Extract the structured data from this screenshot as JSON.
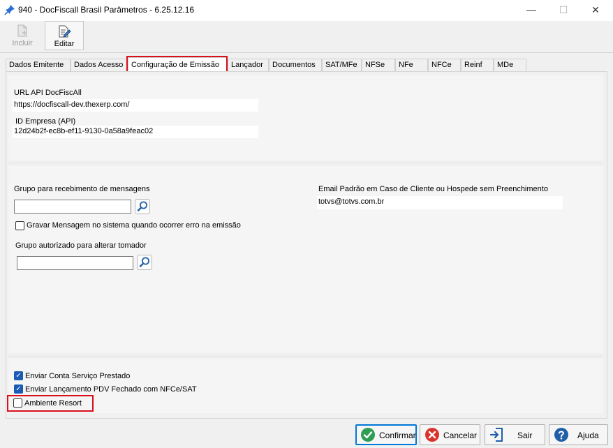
{
  "window": {
    "title": "940 - DocFiscall Brasil Parâmetros - 6.25.12.16",
    "controls": {
      "minimize": "—",
      "maximize": "☐",
      "close": "✕"
    }
  },
  "toolbar": {
    "incluir": "Incluir",
    "editar": "Editar"
  },
  "tabs": [
    "Dados Emitente",
    "Dados Acesso",
    "Configuração de Emissão",
    "Lançador",
    "Documentos",
    "SAT/MFe",
    "NFSe",
    "NFe",
    "NFCe",
    "Reinf",
    "MDe"
  ],
  "api": {
    "url_label": "URL API DocFiscAll",
    "url_value": "https://docfiscall-dev.thexerp.com/",
    "id_label": "ID Empresa (API)",
    "id_value": "12d24b2f-ec8b-ef11-9130-0a58a9feac02"
  },
  "messages": {
    "group_label": "Grupo para recebimento de mensagens",
    "group_value": "",
    "gravar_label": "Gravar Mensagem no sistema quando ocorrer erro na emissão",
    "gravar_checked": false,
    "tomador_label": "Grupo autorizado para alterar tomador",
    "tomador_value": "",
    "email_label": "Email Padrão em Caso de Cliente ou Hospede sem Preenchimento",
    "email_value": "totvs@totvs.com.br"
  },
  "options": {
    "enviar_conta": {
      "label": "Enviar Conta Serviço Prestado",
      "checked": true
    },
    "enviar_pdv": {
      "label": "Enviar Lançamento PDV Fechado com NFCe/SAT",
      "checked": true
    },
    "ambiente_resort": {
      "label": "Ambiente Resort",
      "checked": false
    }
  },
  "buttons": {
    "confirmar": "Confirmar",
    "cancelar": "Cancelar",
    "sair": "Sair",
    "ajuda": "Ajuda"
  },
  "colors": {
    "highlight": "#d7101b",
    "accent": "#1c5bb5",
    "confirm_green": "#2e9e55",
    "cancel_red": "#d9342b",
    "help_blue": "#1f5fa8"
  }
}
